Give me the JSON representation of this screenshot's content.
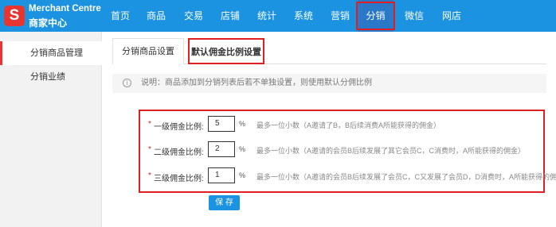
{
  "brand": {
    "logo_letter": "S",
    "name_en": "Merchant Centre",
    "name_cn": "商家中心"
  },
  "nav": {
    "items": [
      {
        "label": "首页"
      },
      {
        "label": "商品"
      },
      {
        "label": "交易"
      },
      {
        "label": "店铺"
      },
      {
        "label": "统计"
      },
      {
        "label": "系统"
      },
      {
        "label": "营销"
      },
      {
        "label": "分销"
      },
      {
        "label": "微信"
      },
      {
        "label": "网店"
      }
    ],
    "active": "分销"
  },
  "sidebar": {
    "items": [
      {
        "label": "分销商品管理"
      },
      {
        "label": "分销业绩"
      }
    ]
  },
  "tabs": [
    {
      "label": "分销商品设置"
    },
    {
      "label": "默认佣金比例设置"
    }
  ],
  "notice": {
    "icon": "info-icon",
    "glyph": "i",
    "text": "说明：商品添加到分销列表后若不单独设置，则使用默认分佣比例"
  },
  "form": {
    "required_mark": "*",
    "unit": "%",
    "rows": [
      {
        "label": "一级佣金比例:",
        "value": "5",
        "hint": "最多一位小数（A邀请了B，B后续消费A所能获得的佣金）"
      },
      {
        "label": "二级佣金比例:",
        "value": "2",
        "hint": "最多一位小数（A邀请的会员B后续发展了其它会员C，C消费时，A所能获得的佣金）"
      },
      {
        "label": "三级佣金比例:",
        "value": "1",
        "hint": "最多一位小数（A邀请的会员B后续发展了会员C，C又发展了会员D，D消费时，A所能获得的佣金）"
      }
    ],
    "save_label": "保 存"
  },
  "colors": {
    "primary": "#1c93e0",
    "brand_red": "#e8352f",
    "highlight": "#e02020"
  }
}
